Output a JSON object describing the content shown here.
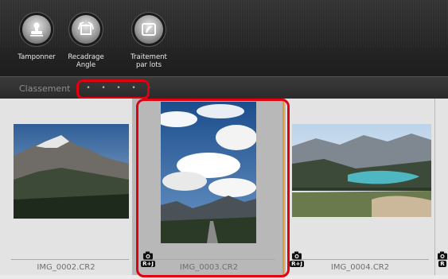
{
  "toolbar": {
    "buttons": [
      {
        "label": "Tamponner",
        "icon": "stamp-icon"
      },
      {
        "label": "Recadrage\nAngle",
        "icon": "crop-rotate-icon"
      },
      {
        "label": "Traitement\npar lots",
        "icon": "batch-process-icon"
      }
    ]
  },
  "classement": {
    "label": "Classement",
    "stars": [
      "•",
      "•",
      "•",
      "•",
      "•"
    ]
  },
  "thumbnails": [
    {
      "filename": "IMG_0002.CR2",
      "selected": false,
      "badge": ""
    },
    {
      "filename": "IMG_0003.CR2",
      "selected": true,
      "badge": "R+J"
    },
    {
      "filename": "IMG_0004.CR2",
      "selected": false,
      "badge": "R+J"
    },
    {
      "filename": "",
      "selected": false,
      "badge": "R"
    }
  ],
  "colors": {
    "highlight": "#e0000f",
    "toolbar_bg": "#262626",
    "grid_bg": "#ebebeb",
    "selected_bg": "#b8b8b8"
  }
}
